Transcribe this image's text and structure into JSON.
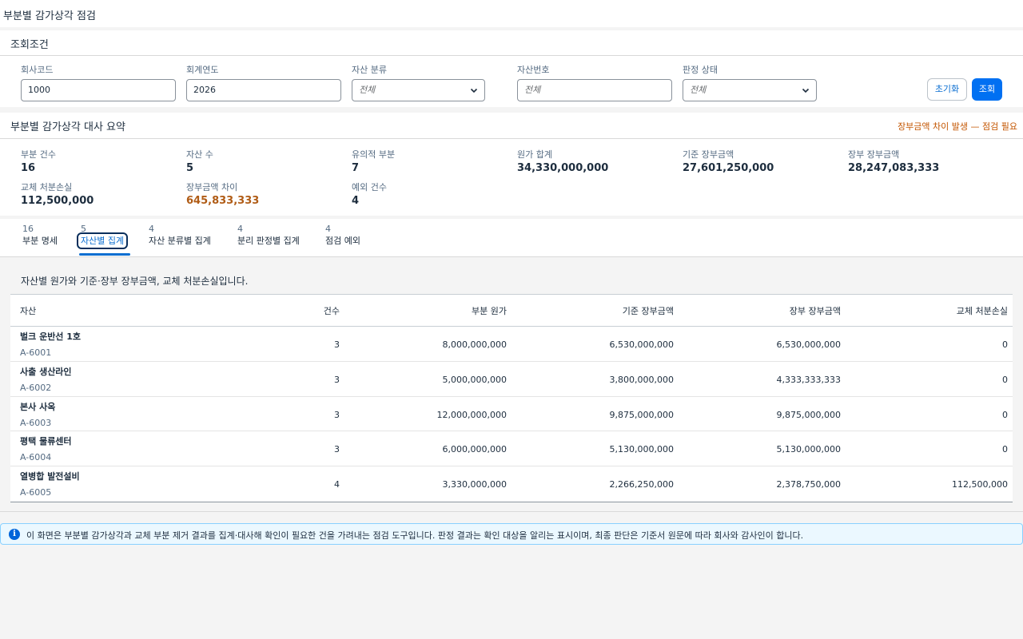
{
  "page": {
    "title": "부분별 감가상각 점검"
  },
  "filters": {
    "section_title": "조회조건",
    "company_code": {
      "label": "회사코드",
      "value": "1000"
    },
    "fiscal_year": {
      "label": "회계연도",
      "value": "2026"
    },
    "asset_class": {
      "label": "자산 분류",
      "value": "전체"
    },
    "asset_number": {
      "label": "자산번호",
      "placeholder": "전체"
    },
    "status": {
      "label": "판정 상태",
      "value": "전체"
    },
    "reset_label": "초기화",
    "search_label": "조회"
  },
  "summary": {
    "section_title": "부분별 감가상각 대사 요약",
    "warning": "장부금액 차이 발생 — 점검 필요",
    "kpis": [
      {
        "label": "부분 건수",
        "value": "16"
      },
      {
        "label": "자산 수",
        "value": "5"
      },
      {
        "label": "유의적 부분",
        "value": "7"
      },
      {
        "label": "원가 합계",
        "value": "34,330,000,000"
      },
      {
        "label": "기준 장부금액",
        "value": "27,601,250,000"
      },
      {
        "label": "장부 장부금액",
        "value": "28,247,083,333"
      },
      {
        "label": "교체 처분손실",
        "value": "112,500,000"
      },
      {
        "label": "장부금액 차이",
        "value": "645,833,333"
      },
      {
        "label": "예외 건수",
        "value": "4"
      }
    ]
  },
  "tabs": [
    {
      "count": "16",
      "label": "부분 명세",
      "active": false
    },
    {
      "count": "5",
      "label": "자산별 집계",
      "active": true
    },
    {
      "count": "4",
      "label": "자산 분류별 집계",
      "active": false
    },
    {
      "count": "4",
      "label": "분리 판정별 집계",
      "active": false
    },
    {
      "count": "4",
      "label": "점검 예외",
      "active": false
    }
  ],
  "content": {
    "description": "자산별 원가와 기준·장부 장부금액, 교체 처분손실입니다."
  },
  "table": {
    "headers": [
      "자산",
      "건수",
      "부분 원가",
      "기준 장부금액",
      "장부 장부금액",
      "교체 처분손실"
    ],
    "rows": [
      {
        "name": "벌크 운반선 1호",
        "id": "A-6001",
        "count": "3",
        "cost": "8,000,000,000",
        "base_bv": "6,530,000,000",
        "book_bv": "6,530,000,000",
        "loss": "0"
      },
      {
        "name": "사출 생산라인",
        "id": "A-6002",
        "count": "3",
        "cost": "5,000,000,000",
        "base_bv": "3,800,000,000",
        "book_bv": "4,333,333,333",
        "loss": "0"
      },
      {
        "name": "본사 사옥",
        "id": "A-6003",
        "count": "3",
        "cost": "12,000,000,000",
        "base_bv": "9,875,000,000",
        "book_bv": "9,875,000,000",
        "loss": "0"
      },
      {
        "name": "평택 물류센터",
        "id": "A-6004",
        "count": "3",
        "cost": "6,000,000,000",
        "base_bv": "5,130,000,000",
        "book_bv": "5,130,000,000",
        "loss": "0"
      },
      {
        "name": "열병합 발전설비",
        "id": "A-6005",
        "count": "4",
        "cost": "3,330,000,000",
        "base_bv": "2,266,250,000",
        "book_bv": "2,378,750,000",
        "loss": "112,500,000"
      }
    ]
  },
  "info": {
    "icon": "info-icon",
    "text": "이 화면은 부분별 감가상각과 교체 부분 제거 결과를 집계·대사해 확인이 필요한 건을 가려내는 점검 도구입니다. 판정 결과는 확인 대상을 알리는 표시이며, 최종 판단은 기준서 원문에 따라 회사와 감사인이 합니다."
  },
  "colors": {
    "accent": "#0070f2",
    "warning": "#c35500",
    "info_bg": "#ebf8ff"
  }
}
